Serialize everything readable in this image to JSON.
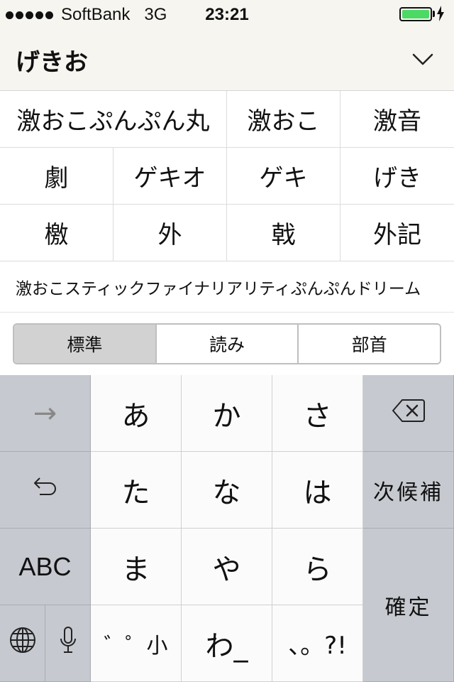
{
  "status_bar": {
    "signal_dots": 5,
    "carrier": "SoftBank",
    "network": "3G",
    "time": "23:21",
    "battery_level": 1.0,
    "battery_color": "#4cd964",
    "charging_icon": "lightning-bolt-icon"
  },
  "header": {
    "reading": "げきお",
    "collapse_icon": "chevron-down-icon"
  },
  "candidates": {
    "row1": [
      "激おこぷんぷん丸",
      "激おこ",
      "激音"
    ],
    "row2": [
      "劇",
      "ゲキオ",
      "ゲキ",
      "げき"
    ],
    "row3": [
      "檄",
      "外",
      "戟",
      "外記"
    ],
    "long": "激おこスティックファイナリアリティぷんぷんドリーム"
  },
  "segments": {
    "items": [
      "標準",
      "読み",
      "部首"
    ],
    "selected": "標準"
  },
  "keyboard": {
    "left_col": {
      "arrow": "→",
      "undo_icon": "undo-arrow-icon",
      "abc": "ABC",
      "globe_icon": "globe-icon",
      "mic_icon": "microphone-icon"
    },
    "keys": [
      "あ",
      "か",
      "さ",
      "た",
      "な",
      "は",
      "ま",
      "や",
      "ら",
      "゛゜小",
      "わ_",
      "、。?!"
    ],
    "right_col": {
      "delete_icon": "delete-backspace-icon",
      "next_candidate": "次候補",
      "confirm": "確定"
    }
  }
}
